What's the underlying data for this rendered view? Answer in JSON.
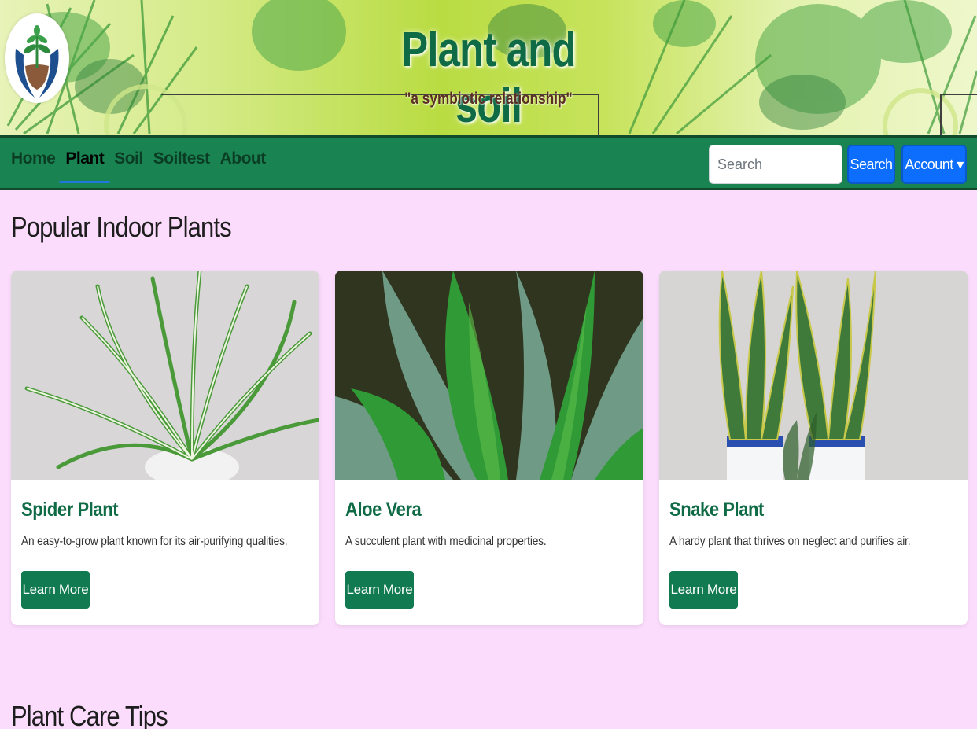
{
  "site": {
    "title": "Plant and soil",
    "tagline": "\"a symbiotic relationship\""
  },
  "nav": {
    "items": [
      {
        "label": "Home",
        "active": false
      },
      {
        "label": "Plant",
        "active": true
      },
      {
        "label": "Soil",
        "active": false
      },
      {
        "label": "Soiltest",
        "active": false
      },
      {
        "label": "About",
        "active": false
      }
    ],
    "search_placeholder": "Search",
    "search_button": "Search",
    "account_button": "Account ▾"
  },
  "main": {
    "section_title": "Popular Indoor Plants",
    "cards": [
      {
        "title": "Spider Plant",
        "description": "An easy-to-grow plant known for its air-purifying qualities.",
        "button": "Learn More",
        "image": "spider-plant-photo"
      },
      {
        "title": "Aloe Vera",
        "description": "A succulent plant with medicinal properties.",
        "button": "Learn More",
        "image": "aloe-vera-photo"
      },
      {
        "title": "Snake Plant",
        "description": "A hardy plant that thrives on neglect and purifies air.",
        "button": "Learn More",
        "image": "snake-plant-photo"
      }
    ],
    "next_section_title": "Plant Care Tips"
  },
  "colors": {
    "page_background": "#fbdcfc",
    "navbar": "#1a8352",
    "brand_green": "#0f6b45",
    "button_blue": "#0d6efd",
    "learn_more_button": "#127a50"
  }
}
